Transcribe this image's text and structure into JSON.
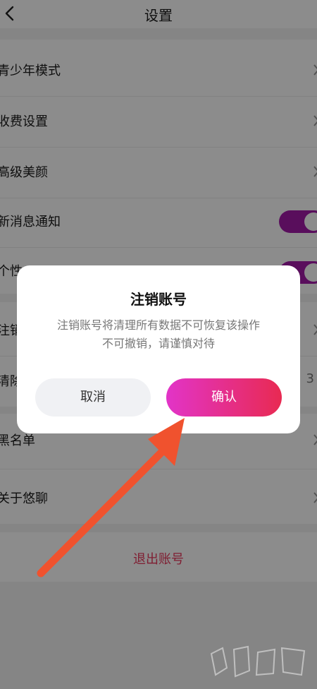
{
  "header": {
    "title": "设置",
    "back_icon": "chevron-left-icon"
  },
  "settings": {
    "items": [
      {
        "label": "青少年模式",
        "control": "chevron"
      },
      {
        "label": "收费设置",
        "control": "chevron"
      },
      {
        "label": "高级美颜",
        "control": "chevron"
      },
      {
        "label": "新消息通知",
        "control": "toggle",
        "on": true
      },
      {
        "label": "个性",
        "control": "toggle",
        "on": true
      },
      {
        "label": "注销",
        "control": "chevron"
      },
      {
        "label": "清除",
        "control": "value",
        "value": "3"
      },
      {
        "label": "黑名单",
        "control": "chevron"
      },
      {
        "label": "关于悠聊",
        "control": "chevron"
      }
    ],
    "logout_label": "退出账号"
  },
  "dialog": {
    "title": "注销账号",
    "message": "注销账号将清理所有数据不可恢复该操作不可撤销，请谨慎对待",
    "cancel_label": "取消",
    "confirm_label": "确认"
  },
  "colors": {
    "accent_toggle": "#a21aa8",
    "confirm_gradient_start": "#e234c8",
    "confirm_gradient_end": "#e82a52",
    "logout_text": "#e8385c",
    "annotation_arrow": "#f0522e"
  }
}
